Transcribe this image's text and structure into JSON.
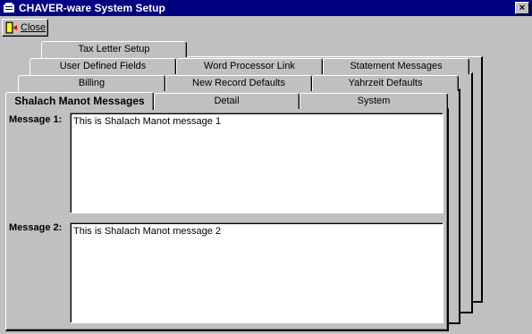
{
  "window": {
    "title": "CHAVER-ware System Setup",
    "close_glyph": "×"
  },
  "toolbar": {
    "close_label": "Close",
    "close_icon": "exit-door-icon"
  },
  "tabs": {
    "row1": [
      {
        "label": "Tax Letter Setup"
      }
    ],
    "row2": [
      {
        "label": "User Defined Fields"
      },
      {
        "label": "Word Processor Link"
      },
      {
        "label": "Statement Messages"
      }
    ],
    "row3": [
      {
        "label": "Billing"
      },
      {
        "label": "New Record Defaults"
      },
      {
        "label": "Yahrzeit Defaults"
      }
    ],
    "row4": [
      {
        "label": "Shalach Manot Messages",
        "active": true
      },
      {
        "label": "Detail"
      },
      {
        "label": "System"
      }
    ]
  },
  "messages": {
    "message1_label": "Message 1:",
    "message1_value": "This is Shalach Manot message 1",
    "message2_label": "Message 2:",
    "message2_value": "This is Shalach Manot message 2"
  },
  "colors": {
    "titlebar": "#000080",
    "background": "#c0c0c0"
  }
}
